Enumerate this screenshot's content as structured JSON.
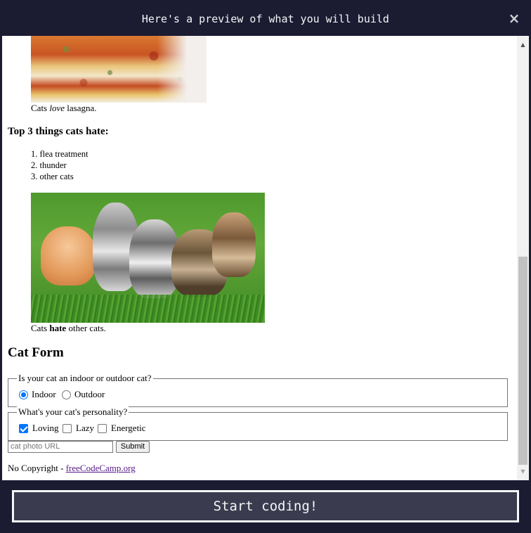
{
  "modal": {
    "title": "Here's a preview of what you will build",
    "close_label": "×",
    "start_button": "Start coding!"
  },
  "preview": {
    "lasagna_caption": {
      "before": "Cats ",
      "emphasis": "love",
      "after": " lasagna."
    },
    "hate_heading": "Top 3 things cats hate:",
    "hate_list": [
      "flea treatment",
      "thunder",
      "other cats"
    ],
    "kittens_caption": {
      "before": "Cats ",
      "strong": "hate",
      "after": " other cats."
    },
    "form_heading": "Cat Form",
    "indoor_outdoor": {
      "legend": "Is your cat an indoor or outdoor cat?",
      "options": [
        {
          "label": "Indoor",
          "checked": true
        },
        {
          "label": "Outdoor",
          "checked": false
        }
      ]
    },
    "personality": {
      "legend": "What's your cat's personality?",
      "options": [
        {
          "label": "Loving",
          "checked": true
        },
        {
          "label": "Lazy",
          "checked": false
        },
        {
          "label": "Energetic",
          "checked": false
        }
      ]
    },
    "url_placeholder": "cat photo URL",
    "submit_label": "Submit",
    "footer_prefix": "No Copyright - ",
    "footer_link": "freeCodeCamp.org"
  },
  "scrollbar": {
    "up_icon": "▲",
    "down_icon": "▼"
  }
}
